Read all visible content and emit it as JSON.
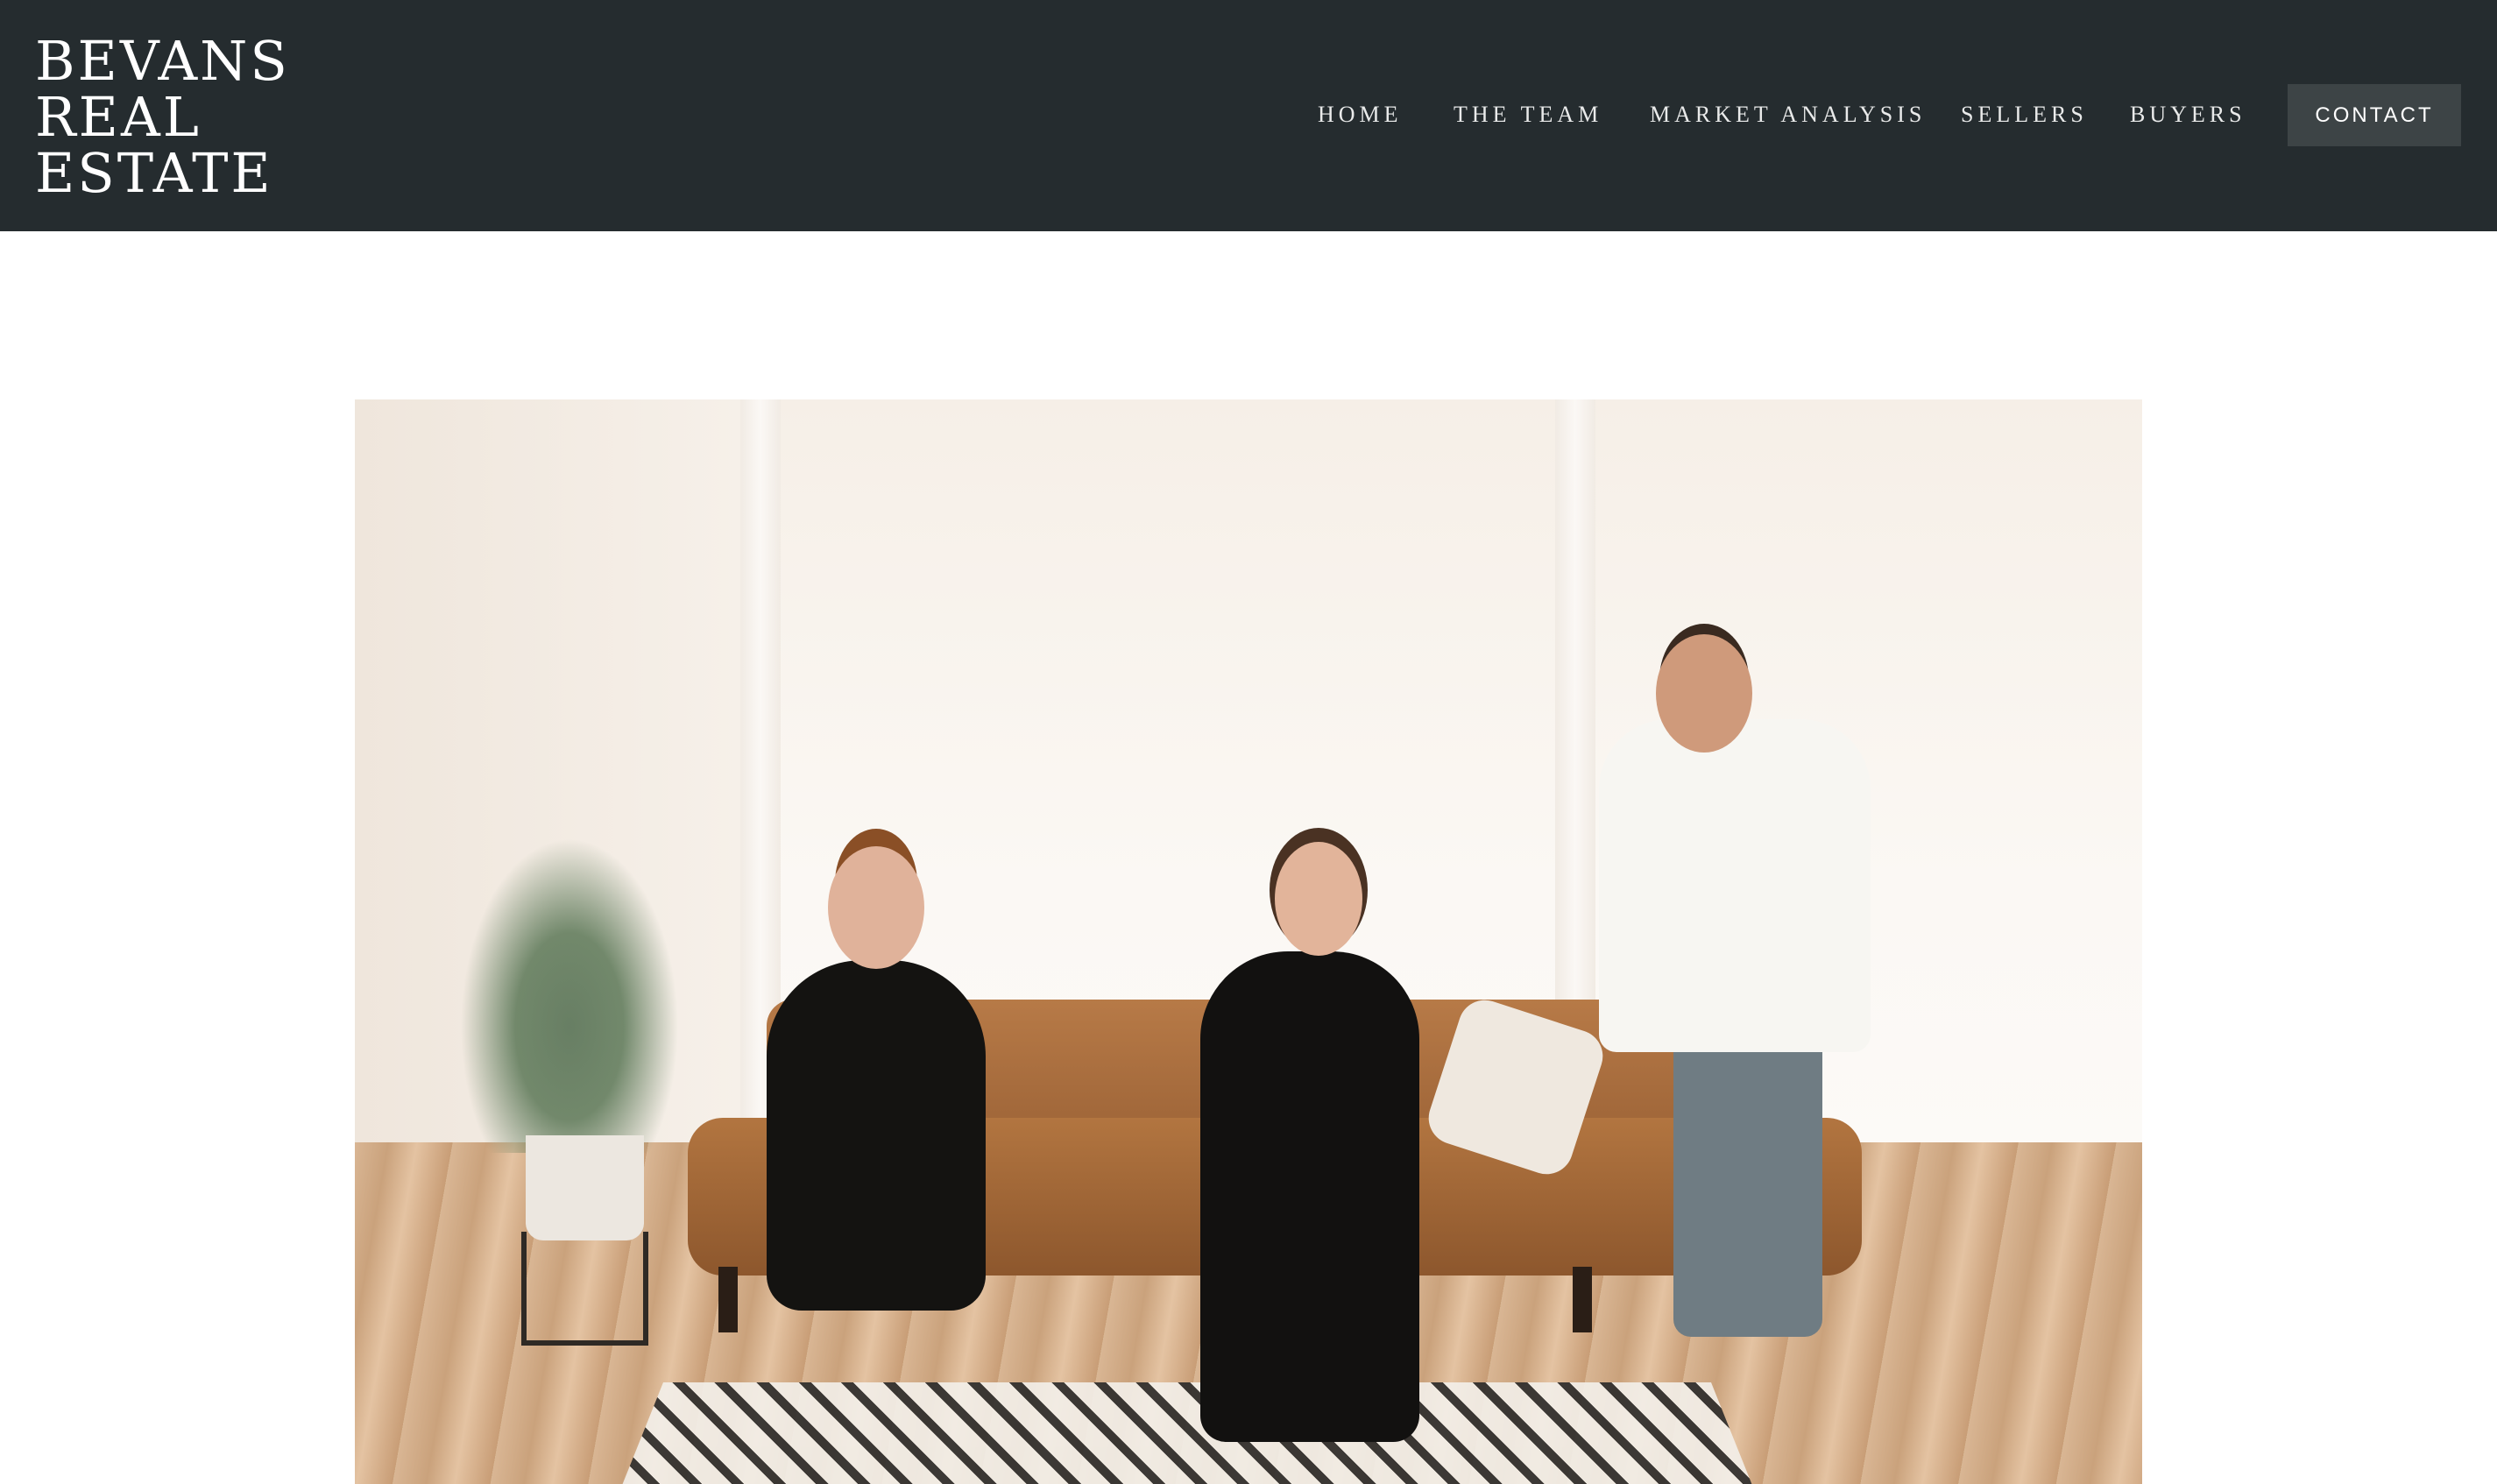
{
  "header": {
    "logo_lines": [
      "BEVANS",
      "REAL",
      "ESTATE"
    ],
    "nav": {
      "home": "HOME",
      "team": "THE TEAM",
      "market": "MARKET ANALYSIS",
      "sellers": "SELLERS",
      "buyers": "BUYERS"
    },
    "contact_label": "CONTACT"
  },
  "colors": {
    "header_bg": "#252c2f",
    "contact_bg": "#3d4446",
    "nav_text": "#e9eaea"
  },
  "hero": {
    "image_semantic": "team-photo"
  }
}
